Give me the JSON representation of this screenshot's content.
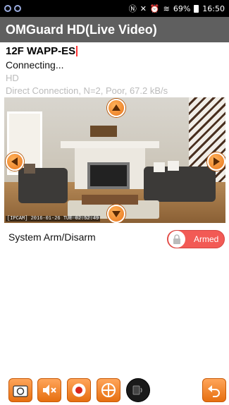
{
  "status_bar": {
    "signal_text": "69%",
    "time": "16:50"
  },
  "app_bar": {
    "title": "OMGuard HD(Live Video)"
  },
  "device": {
    "name": "12F WAPP-ES",
    "state": "Connecting...",
    "quality": "HD",
    "connection": "Direct Connection, N=2, Poor,  67.2 kB/s"
  },
  "video": {
    "timestamp": "[IPCAM]  2016-01-26 TUE 02:52:49"
  },
  "arm": {
    "label": "System Arm/Disarm",
    "state": "Armed"
  },
  "colors": {
    "accent_orange": "#e8751c",
    "armed_red": "#f25a55",
    "app_bar_gray": "#5f5f5f"
  },
  "toolbar": {
    "icons": [
      "camera-icon",
      "mute-icon",
      "record-icon",
      "ptz-target-icon",
      "talk-icon",
      "back-icon"
    ]
  }
}
